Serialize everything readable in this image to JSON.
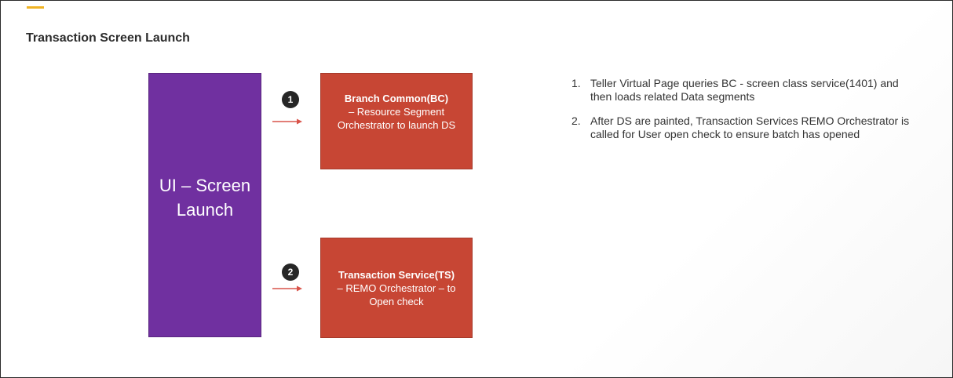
{
  "slide": {
    "title": "Transaction Screen Launch",
    "accent_color": "#f0b323"
  },
  "diagram": {
    "ui_box": {
      "label": "UI – Screen Launch",
      "color": "#7030a0"
    },
    "steps": [
      {
        "number": "1",
        "title": "Branch Common(BC)",
        "body": "– Resource Segment Orchestrator to launch DS",
        "color": "#c74634"
      },
      {
        "number": "2",
        "title": "Transaction Service(TS)",
        "body": "– REMO Orchestrator – to Open check",
        "color": "#c74634"
      }
    ],
    "arrow_color": "#c74634"
  },
  "notes": [
    {
      "number": "1.",
      "text": "Teller Virtual Page queries BC - screen class service(1401)  and then loads related Data segments"
    },
    {
      "number": "2.",
      "text": " After DS are painted, Transaction Services REMO Orchestrator is called for User open check to ensure batch has opened"
    }
  ]
}
